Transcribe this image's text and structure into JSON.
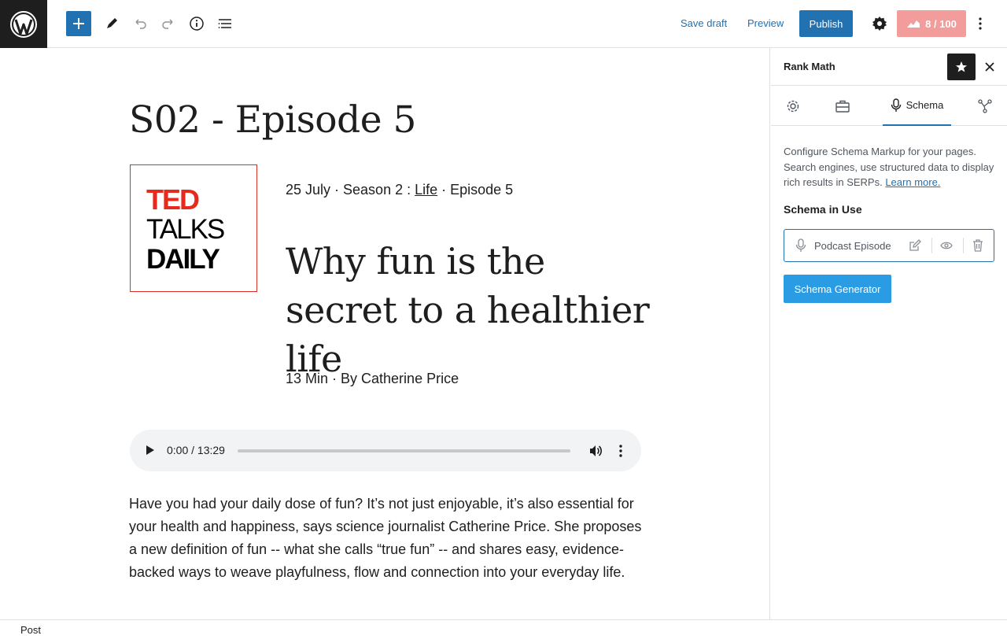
{
  "toolbar": {
    "save_draft": "Save draft",
    "preview": "Preview",
    "publish": "Publish",
    "score": "8 / 100"
  },
  "post": {
    "title": "S02 - Episode 5",
    "cover": {
      "line1": "TED",
      "line2": "TALKS",
      "line3": "DAILY"
    },
    "meta_prefix": "25 July · Season 2 : ",
    "meta_link": "Life",
    "meta_suffix": " · Episode 5",
    "episode_title": "Why fun is the secret to a healthier life",
    "duration": "13 Min · By Catherine Price",
    "audio_time": "0:00 / 13:29",
    "body": "Have you had your daily dose of fun? It’s not just enjoyable, it’s also essential for your health and happiness, says science journalist Catherine Price. She proposes a new definition of fun -- what she calls “true fun” -- and shares easy, evidence-backed ways to weave playfulness, flow and connection into your everyday life."
  },
  "sidebar": {
    "title": "Rank Math",
    "tabs": [
      {
        "label": "",
        "icon": "gear-icon"
      },
      {
        "label": "",
        "icon": "briefcase-icon"
      },
      {
        "label": "Schema",
        "icon": "microphone-icon"
      },
      {
        "label": "",
        "icon": "social-icon"
      }
    ],
    "description": "Configure Schema Markup for your pages. Search engines, use structured data to display rich results in SERPs.",
    "learn_more": "Learn more.",
    "section_title": "Schema in Use",
    "schema_item": "Podcast Episode",
    "generator_button": "Schema Generator"
  },
  "footer": {
    "breadcrumb": "Post"
  },
  "colors": {
    "accent": "#2271b1",
    "score_bg": "#f39c9c",
    "ted_red": "#e62b1e"
  }
}
